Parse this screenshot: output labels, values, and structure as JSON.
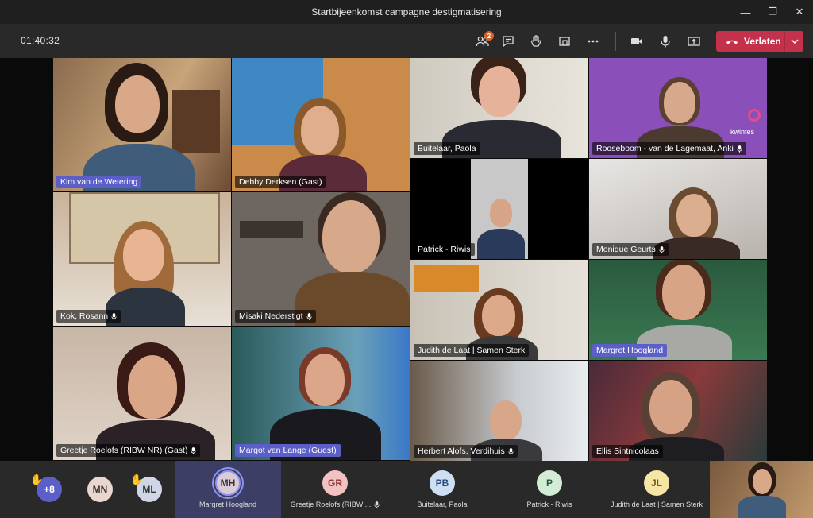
{
  "window": {
    "title": "Startbijeenkomst campagne destigmatisering",
    "minimize": "—",
    "maximize": "❐",
    "close": "✕"
  },
  "toolbar": {
    "timer": "01:40:32",
    "participants_badge": "2",
    "leave_label": "Verlaten"
  },
  "tiles": [
    {
      "name": "Kim van de Wetering",
      "selected": true,
      "mic": false
    },
    {
      "name": "Debby Derksen (Gast)",
      "selected": false,
      "mic": false
    },
    {
      "name": "Buitelaar, Paola",
      "selected": false,
      "mic": false
    },
    {
      "name": "Rooseboom - van de Lagemaat, Anki",
      "selected": false,
      "mic": true,
      "logo": "kwintes"
    },
    {
      "name": "Patrick - Riwis",
      "selected": false,
      "mic": false
    },
    {
      "name": "Monique Geurts",
      "selected": false,
      "mic": true
    },
    {
      "name": "Kok, Rosann",
      "selected": false,
      "mic": true
    },
    {
      "name": "Misaki Nederstigt",
      "selected": false,
      "mic": true
    },
    {
      "name": "Judith de Laat | Samen Sterk",
      "selected": false,
      "mic": false
    },
    {
      "name": "Margret Hoogland",
      "selected": true,
      "mic": false
    },
    {
      "name": "Greetje Roelofs (RIBW NR) (Gast)",
      "selected": false,
      "mic": true
    },
    {
      "name": "Margot van Lange (Guest)",
      "selected": true,
      "mic": false
    },
    {
      "name": "Herbert Alofs, Verdihuis",
      "selected": false,
      "mic": true
    },
    {
      "name": "Ellis Sintnicolaas",
      "selected": false,
      "mic": false
    }
  ],
  "tray": [
    {
      "initials": "+8",
      "label": "",
      "hand": true
    },
    {
      "initials": "MN",
      "label": "",
      "hand": false
    },
    {
      "initials": "ML",
      "label": "",
      "hand": true
    },
    {
      "initials": "MH",
      "label": "Margret Hoogland",
      "hand": false
    },
    {
      "initials": "GR",
      "label": "Greetje Roelofs (RIBW ...",
      "hand": false,
      "mic": true
    },
    {
      "initials": "PB",
      "label": "Buitelaar, Paola",
      "hand": false
    },
    {
      "initials": "P",
      "label": "Patrick - Riwis",
      "hand": false
    },
    {
      "initials": "JL",
      "label": "Judith de Laat | Samen Sterk",
      "hand": false
    }
  ],
  "colors": {
    "accent": "#5b5fc7",
    "leave": "#c4314b",
    "badge": "#d4622a"
  }
}
